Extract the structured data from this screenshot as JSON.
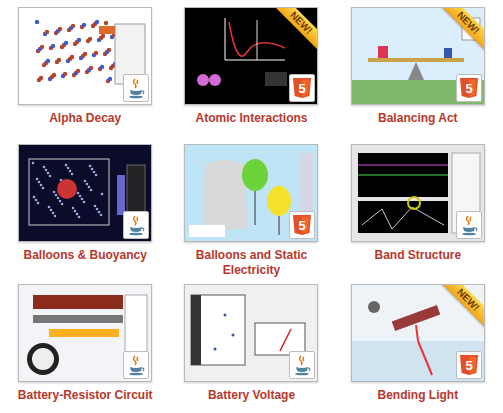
{
  "simulations": [
    {
      "title": "Alpha Decay",
      "new": false,
      "badge": {
        "kind": "java"
      },
      "thumbnail": {
        "kind": "particles"
      }
    },
    {
      "title": "Atomic Interactions",
      "new": true,
      "ribbon": "NEW!",
      "badge": {
        "kind": "html5",
        "text": "5"
      },
      "thumbnail": {
        "kind": "graph-dark"
      }
    },
    {
      "title": "Balancing Act",
      "new": true,
      "ribbon": "NEW!",
      "badge": {
        "kind": "html5",
        "text": "5"
      },
      "thumbnail": {
        "kind": "seesaw"
      }
    },
    {
      "title": "Balloons & Buoyancy",
      "new": false,
      "badge": {
        "kind": "java"
      },
      "thumbnail": {
        "kind": "chamber"
      }
    },
    {
      "title": "Balloons and Static Electricity",
      "new": false,
      "badge": {
        "kind": "html5",
        "text": "5"
      },
      "thumbnail": {
        "kind": "balloons"
      }
    },
    {
      "title": "Band Structure",
      "new": false,
      "badge": {
        "kind": "java"
      },
      "thumbnail": {
        "kind": "plot"
      }
    },
    {
      "title": "Battery-Resistor Circuit",
      "new": false,
      "badge": {
        "kind": "java"
      },
      "thumbnail": {
        "kind": "circuit"
      }
    },
    {
      "title": "Battery Voltage",
      "new": false,
      "badge": {
        "kind": "java"
      },
      "thumbnail": {
        "kind": "battery"
      }
    },
    {
      "title": "Bending Light",
      "new": true,
      "ribbon": "NEW!",
      "badge": {
        "kind": "html5",
        "text": "5"
      },
      "thumbnail": {
        "kind": "laser"
      }
    }
  ]
}
